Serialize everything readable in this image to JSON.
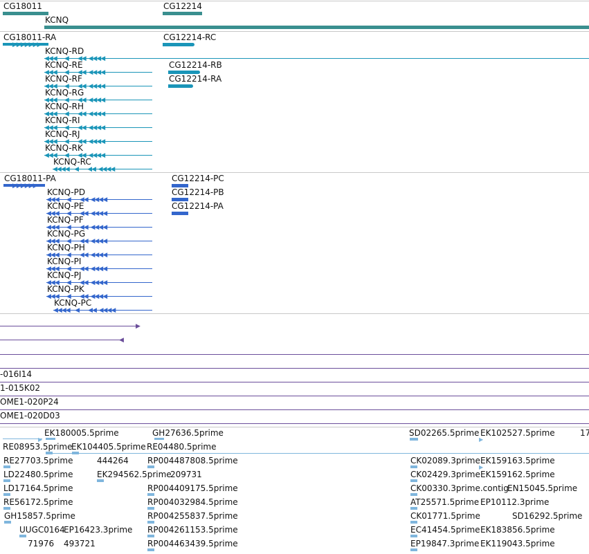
{
  "colors": {
    "gene": "#3a8f8f",
    "transcript_ra": "#1a95b8",
    "transcript_pa": "#3366cc",
    "feature_track": "#6a4d9a",
    "est": "#7fb6dd",
    "separator": "#c8c8c8"
  },
  "gene_track": {
    "genes": [
      {
        "name": "CG18011"
      },
      {
        "name": "CG12214"
      },
      {
        "name": "KCNQ"
      }
    ]
  },
  "mrna_track": {
    "labels": [
      "CG18011-RA",
      "CG12214-RC",
      "KCNQ-RD",
      "KCNQ-RE",
      "CG12214-RB",
      "KCNQ-RF",
      "CG12214-RA",
      "KCNQ-RG",
      "KCNQ-RH",
      "KCNQ-RI",
      "KCNQ-RJ",
      "KCNQ-RK",
      "KCNQ-RC"
    ]
  },
  "protein_track": {
    "labels": [
      "CG18011-PA",
      "CG12214-PC",
      "KCNQ-PD",
      "CG12214-PB",
      "KCNQ-PE",
      "CG12214-PA",
      "KCNQ-PF",
      "KCNQ-PG",
      "KCNQ-PH",
      "KCNQ-PI",
      "KCNQ-PJ",
      "KCNQ-PK",
      "KCNQ-PC"
    ]
  },
  "clone_track": {
    "labels": [
      "-016I14",
      "1-015K02",
      "OME1-020P24",
      "OME1-020D03"
    ]
  },
  "est_track": {
    "labels": [
      "EK180005.5prime",
      "GH27636.5prime",
      "SD02265.5prime",
      "EK102527.5prime",
      "17",
      "RE08953.5prime",
      "EK104405.5prime",
      "RE04480.5prime",
      "RE27703.5prime",
      "444264",
      "RP004487808.5prime",
      "CK02089.3prime",
      "EK159163.5prime",
      "LD22480.5prime",
      "EK294562.5prime",
      "209731",
      "CK02429.3prime",
      "EK159162.5prime",
      "LD17164.5prime",
      "RP004409175.5prime",
      "CK00330.3prime.contig",
      "EN15045.5prime",
      "RE56172.5prime",
      "RP004032984.5prime",
      "AT25571.5prime",
      "EP10112.3prime",
      "GH15857.5prime",
      "RP004255837.5prime",
      "CK01771.5prime",
      "SD16292.5prime",
      "UUGC0164",
      "EP16423.3prime",
      "RP004261153.5prime",
      "EC41454.5prime",
      "EK183856.5prime",
      "71976",
      "493721",
      "RP004463439.5prime",
      "EP19847.3prime",
      "EK119043.5prime"
    ]
  }
}
